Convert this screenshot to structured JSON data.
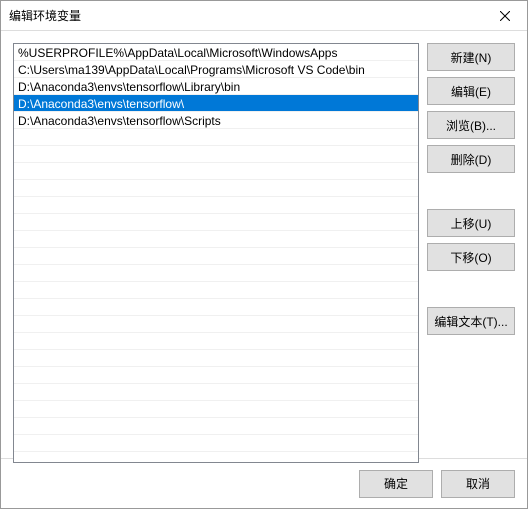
{
  "title": "编辑环境变量",
  "list": {
    "items": [
      "%USERPROFILE%\\AppData\\Local\\Microsoft\\WindowsApps",
      "C:\\Users\\ma139\\AppData\\Local\\Programs\\Microsoft VS Code\\bin",
      "D:\\Anaconda3\\envs\\tensorflow\\Library\\bin",
      "D:\\Anaconda3\\envs\\tensorflow\\",
      "D:\\Anaconda3\\envs\\tensorflow\\Scripts"
    ],
    "selected_index": 3
  },
  "buttons": {
    "new": "新建(N)",
    "edit": "编辑(E)",
    "browse": "浏览(B)...",
    "delete": "删除(D)",
    "move_up": "上移(U)",
    "move_down": "下移(O)",
    "edit_text": "编辑文本(T)...",
    "ok": "确定",
    "cancel": "取消"
  }
}
